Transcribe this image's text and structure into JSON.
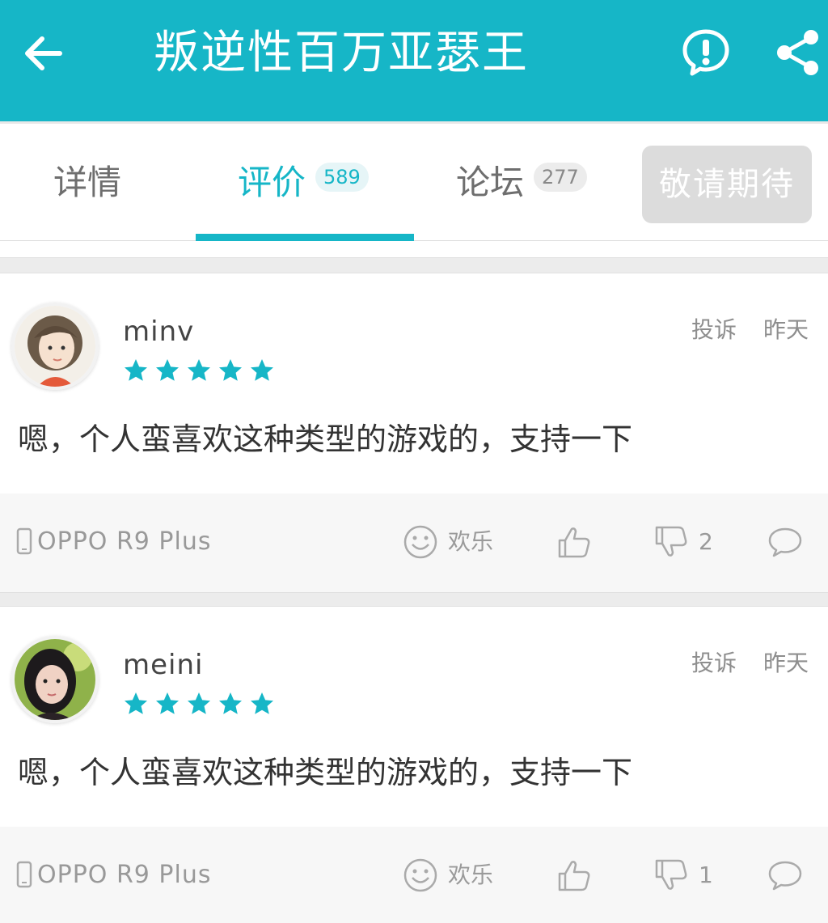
{
  "header": {
    "title": "叛逆性百万亚瑟王",
    "back_icon": "back-arrow-icon",
    "report_icon": "exclamation-icon",
    "share_icon": "share-icon",
    "bg_color": "#16b6c7"
  },
  "tabs": [
    {
      "label": "详情",
      "badge": null,
      "active": false
    },
    {
      "label": "评价",
      "badge": "589",
      "active": true
    },
    {
      "label": "论坛",
      "badge": "277",
      "active": false
    }
  ],
  "coming_soon_label": "敬请期待",
  "accent_color": "#16b6c7",
  "reviews": [
    {
      "username": "minv",
      "rating": 5,
      "report_label": "投诉",
      "time": "昨天",
      "content": "嗯，个人蛮喜欢这种类型的游戏的，支持一下",
      "device": "OPPO R9 Plus",
      "mood": "欢乐",
      "dislike_count": "2"
    },
    {
      "username": "meini",
      "rating": 5,
      "report_label": "投诉",
      "time": "昨天",
      "content": "嗯，个人蛮喜欢这种类型的游戏的，支持一下",
      "device": "OPPO R9 Plus",
      "mood": "欢乐",
      "dislike_count": "1"
    }
  ]
}
